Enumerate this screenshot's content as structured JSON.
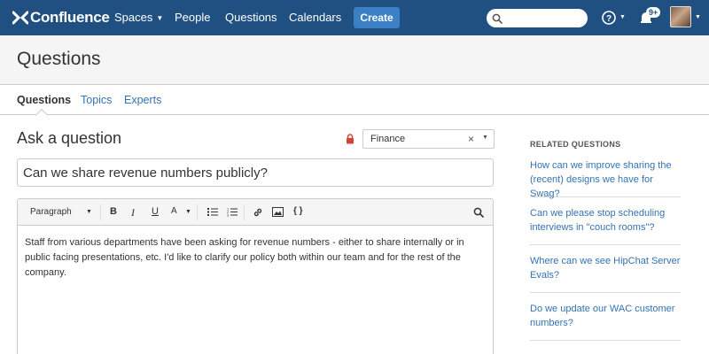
{
  "nav": {
    "logo_text": "Confluence",
    "spaces": "Spaces",
    "people": "People",
    "questions": "Questions",
    "calendars": "Calendars",
    "create": "Create",
    "notification_count": "9+"
  },
  "header": {
    "title": "Questions"
  },
  "tabs": [
    {
      "label": "Questions"
    },
    {
      "label": "Topics"
    },
    {
      "label": "Experts"
    }
  ],
  "form": {
    "heading": "Ask a question",
    "space_value": "Finance",
    "clear_glyph": "×",
    "title_value": "Can we share revenue numbers publicly?",
    "toolbar": {
      "paragraph": "Paragraph",
      "bold": "B",
      "italic": "I",
      "underline": "U",
      "color": "A",
      "code": "{ }"
    },
    "body": "Staff from various departments have been asking for revenue numbers - either to share internally or in public facing presentations, etc. I'd like to clarify our policy both within our team and for the rest of the company."
  },
  "sidebar": {
    "heading": "RELATED QUESTIONS",
    "items": [
      {
        "label": "How can we improve sharing the (recent) designs we have for Swag?"
      },
      {
        "label": "Can we please stop scheduling interviews in \"couch rooms\"?"
      },
      {
        "label": "Where can we see HipChat Server Evals?"
      },
      {
        "label": "Do we update our WAC customer numbers?"
      }
    ]
  },
  "colors": {
    "nav_bg": "#205081",
    "create_bg": "#3b7fc4",
    "link": "#3572b0",
    "lock": "#d04437"
  },
  "icons": [
    "confluence-logo-icon",
    "search-icon",
    "help-icon",
    "notifications-icon",
    "lock-icon",
    "bullet-list-icon",
    "numbered-list-icon",
    "link-icon",
    "image-icon",
    "editor-search-icon"
  ]
}
